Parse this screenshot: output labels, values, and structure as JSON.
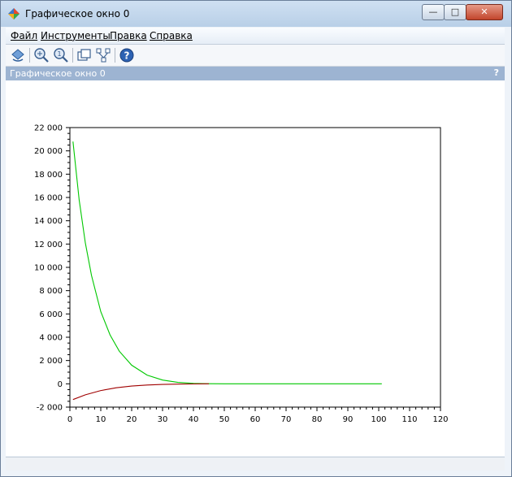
{
  "window": {
    "title": "Графическое окно 0",
    "controls": {
      "minimize": "—",
      "maximize": "□",
      "close": "✕"
    }
  },
  "menu": {
    "items": [
      {
        "label": "Файл"
      },
      {
        "label": "Инструменты"
      },
      {
        "label": "Правка"
      },
      {
        "label": "Справка"
      }
    ]
  },
  "toolbar": {
    "icons": [
      "rotate-icon",
      "zoom-in-icon",
      "zoom-out-icon",
      "new-window-icon",
      "datatip-icon",
      "help-icon"
    ]
  },
  "panel": {
    "title": "Графическое окно 0",
    "help_glyph": "?"
  },
  "chart_data": {
    "type": "line",
    "title": "",
    "xlabel": "",
    "ylabel": "",
    "xlim": [
      0,
      120
    ],
    "ylim": [
      -2000,
      22000
    ],
    "x_ticks": [
      "0",
      "10",
      "20",
      "30",
      "40",
      "50",
      "60",
      "70",
      "80",
      "90",
      "100",
      "110",
      "120"
    ],
    "y_ticks": [
      "-2 000",
      "0",
      "2 000",
      "4 000",
      "6 000",
      "8 000",
      "10 000",
      "12 000",
      "14 000",
      "16 000",
      "18 000",
      "20 000",
      "22 000"
    ],
    "grid": false,
    "series": [
      {
        "color": "#00c800",
        "x": [
          1,
          3,
          5,
          7,
          10,
          13,
          16,
          20,
          25,
          30,
          35,
          40,
          45,
          50,
          60,
          70,
          80,
          90,
          101
        ],
        "y": [
          20800,
          15800,
          12100,
          9300,
          6200,
          4200,
          2800,
          1600,
          750,
          320,
          120,
          40,
          10,
          0,
          0,
          0,
          0,
          0,
          0
        ]
      },
      {
        "color": "#a00000",
        "x": [
          1,
          5,
          10,
          15,
          20,
          25,
          30,
          35,
          40,
          45
        ],
        "y": [
          -1350,
          -950,
          -580,
          -340,
          -190,
          -100,
          -50,
          -25,
          -10,
          0
        ]
      }
    ]
  }
}
